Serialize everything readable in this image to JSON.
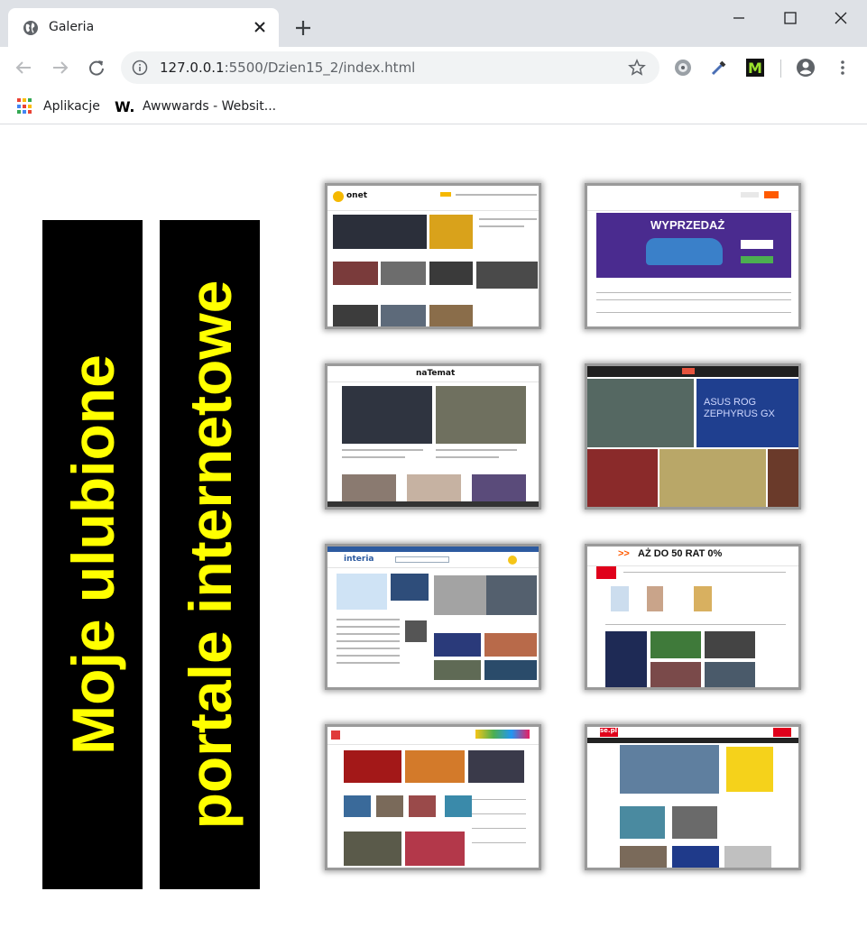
{
  "browser": {
    "tab_title": "Galeria",
    "url_host": "127.0.0.1",
    "url_rest": ":5500/Dzien15_2/index.html"
  },
  "bookmarks": [
    {
      "label": "Aplikacje",
      "icon": "apps-grid-icon"
    },
    {
      "label": "Awwwards - Websit...",
      "icon": "awwwards-logo-icon"
    }
  ],
  "banners": [
    {
      "text": "Moje ulubione"
    },
    {
      "text": "portale internetowe"
    }
  ],
  "gallery": [
    {
      "site": "onet",
      "logo": "onet"
    },
    {
      "site": "allegro-like",
      "ad": "WYPRZEDAŻ"
    },
    {
      "site": "natemat",
      "logo": "naTemat"
    },
    {
      "site": "tech",
      "ad": "ASUS ROG ZEPHYRUS GX"
    },
    {
      "site": "interia",
      "logo": "interia"
    },
    {
      "site": "wp",
      "ad": "AŻ DO 50 RAT 0%"
    },
    {
      "site": "tvn",
      "logo": ""
    },
    {
      "site": "se",
      "logo": "se.pl"
    }
  ],
  "colors": {
    "banner_bg": "#000000",
    "banner_text": "#ffff00",
    "chrome_bg": "#dee1e6"
  }
}
